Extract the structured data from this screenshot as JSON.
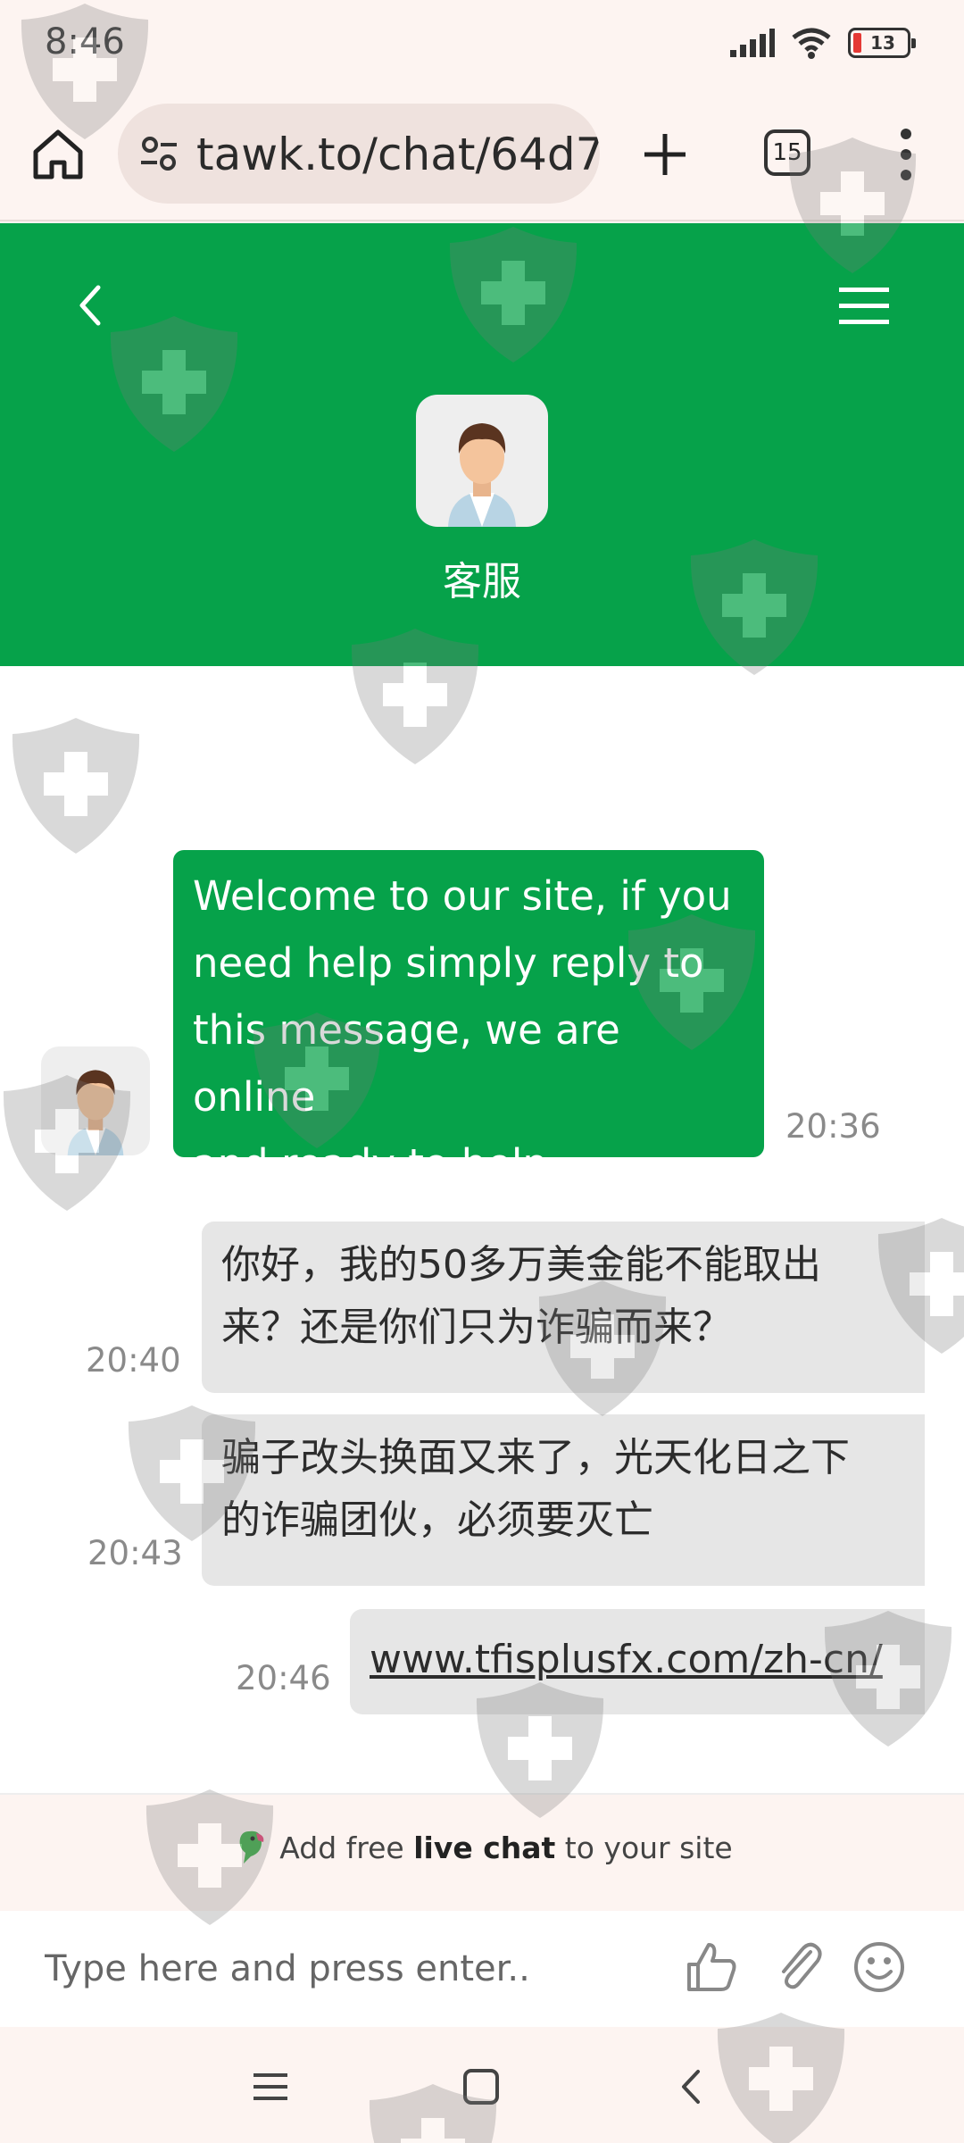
{
  "status_bar": {
    "time": "8:46",
    "battery": "13"
  },
  "browser": {
    "url": "tawk.to/chat/64d7",
    "tab_count": "15"
  },
  "chat_header": {
    "agent_name": "客服"
  },
  "messages": [
    {
      "from": "agent",
      "lines": [
        "Welcome to our site, if you",
        "need help simply reply to",
        "this message, we are online",
        "and ready to help."
      ],
      "time": "20:36"
    },
    {
      "from": "visitor",
      "lines": [
        "你好，我的50多万美金能不能取出",
        "来？还是你们只为诈骗而来？"
      ],
      "time": "20:40"
    },
    {
      "from": "visitor",
      "lines": [
        "骗子改头换面又来了，光天化日之下",
        "的诈骗团伙，必须要灭亡"
      ],
      "time": "20:43"
    },
    {
      "from": "visitor",
      "link": "www.tfisplusfx.com/zh-cn/",
      "time": "20:46"
    }
  ],
  "branding": {
    "prefix": "Add free ",
    "bold": "live chat",
    "suffix": " to your site"
  },
  "composer": {
    "placeholder": "Type here and press enter.."
  },
  "colors": {
    "brand_green": "#06a24a",
    "bubble_gray": "#e6e6e6",
    "browser_bg": "#fdf4f1"
  }
}
